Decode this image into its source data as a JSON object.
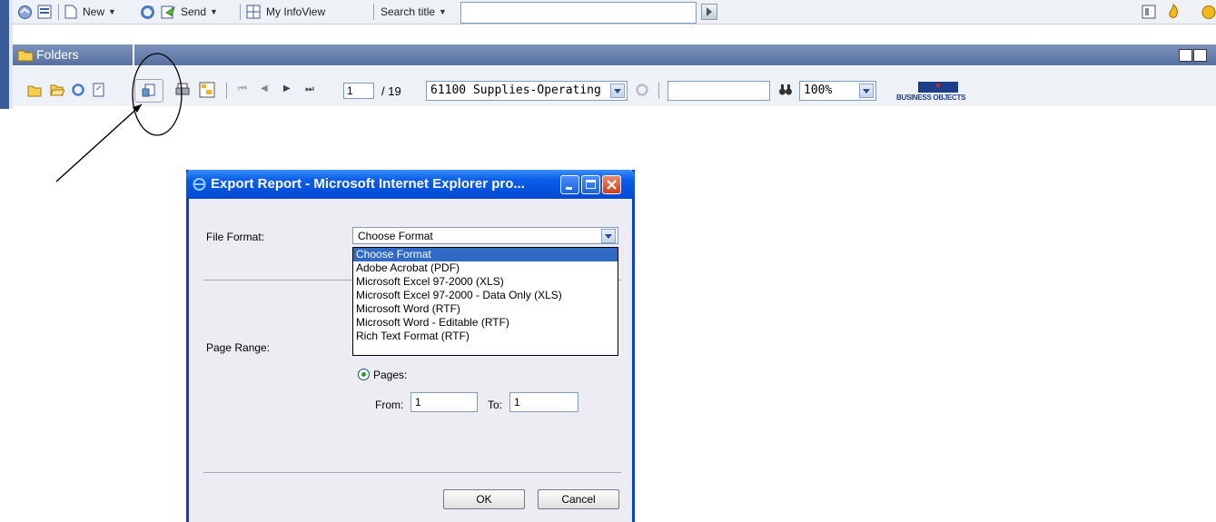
{
  "toolbar": {
    "new_label": "New",
    "send_label": "Send",
    "myinfoview_label": "My InfoView",
    "search_mode_label": "Search title",
    "search_value": ""
  },
  "folders": {
    "header_label": "Folders"
  },
  "viewer": {
    "page_value": "1",
    "page_total": "/ 19",
    "group_selected": "61100 Supplies-Operating",
    "find_value": "",
    "zoom_value": "100%",
    "logo_text": "BUSINESS OBJECTS"
  },
  "dialog": {
    "title": "Export Report - Microsoft Internet Explorer pro...",
    "file_format_label": "File Format:",
    "format_selected": "Choose Format",
    "format_options": [
      "Choose Format",
      "Adobe Acrobat (PDF)",
      "Microsoft Excel 97-2000 (XLS)",
      "Microsoft Excel 97-2000 - Data Only (XLS)",
      "Microsoft Word (RTF)",
      "Microsoft Word - Editable (RTF)",
      "Rich Text Format (RTF)"
    ],
    "page_range_label": "Page Range:",
    "pages_option_label": "Pages:",
    "from_label": "From:",
    "from_value": "1",
    "to_label": "To:",
    "to_value": "1",
    "ok_label": "OK",
    "cancel_label": "Cancel"
  },
  "colors": {
    "xp_title_blue": "#0349d3",
    "selected_option": "#316ac5",
    "header_band": "#56709f"
  }
}
